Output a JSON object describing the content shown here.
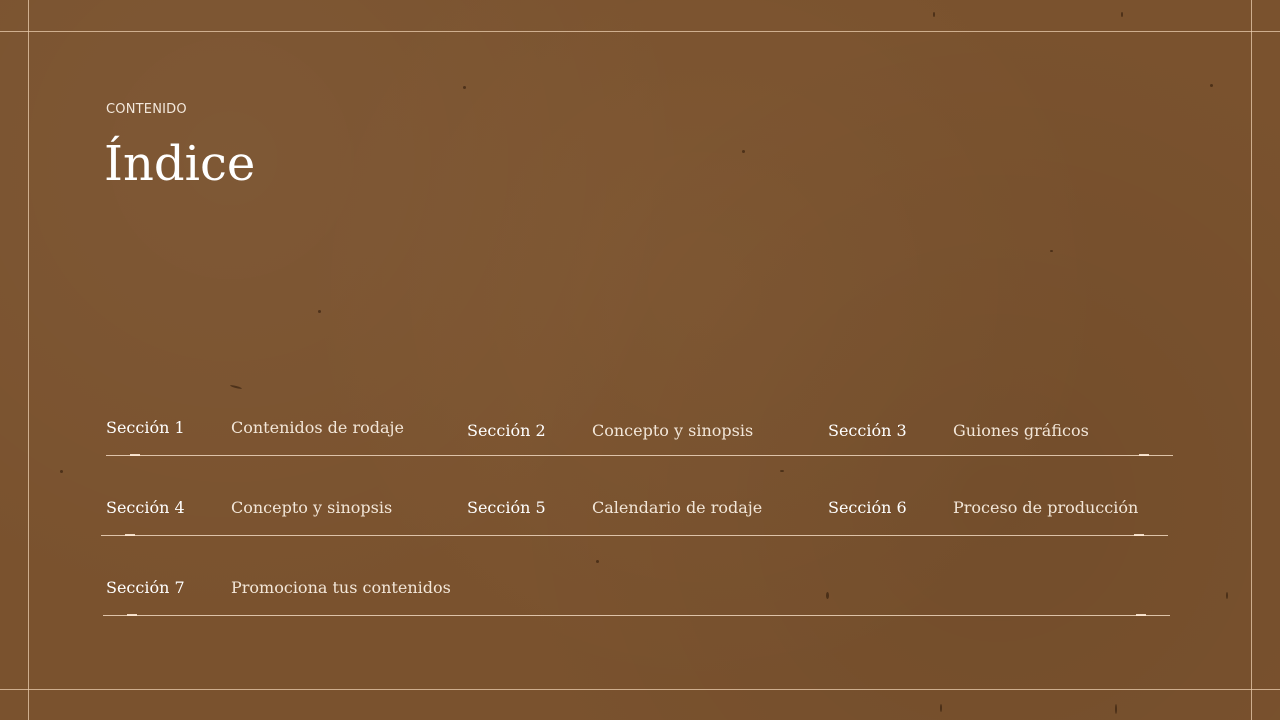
{
  "header": {
    "eyebrow": "CONTENIDO",
    "title": "Índice"
  },
  "sections": [
    {
      "label": "Sección 1",
      "description": "Contenidos de rodaje"
    },
    {
      "label": "Sección 2",
      "description": "Concepto y sinopsis"
    },
    {
      "label": "Sección 3",
      "description": "Guiones gráficos"
    },
    {
      "label": "Sección 4",
      "description": "Concepto y sinopsis"
    },
    {
      "label": "Sección 5",
      "description": "Calendario de rodaje"
    },
    {
      "label": "Sección 6",
      "description": "Proceso de producción"
    },
    {
      "label": "Sección 7",
      "description": "Promociona tus contenidos"
    }
  ],
  "theme": {
    "background": "#7a522e",
    "text": "#ffffff",
    "rule": "#f0d7be"
  }
}
